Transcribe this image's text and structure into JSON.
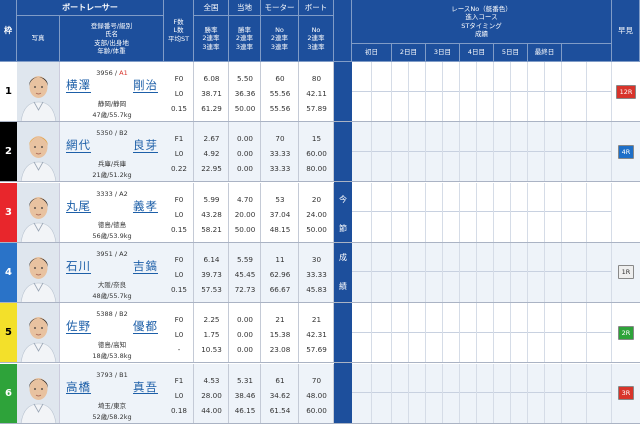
{
  "header": {
    "waku": "枠",
    "boat_racer": "ボートレーサー",
    "photo": "写真",
    "racer_info_lines": [
      "登録番号/級別",
      "氏名",
      "支部/出身地",
      "年齢/体重"
    ],
    "fl_st_lines": [
      "F数",
      "L数",
      "平均ST"
    ],
    "national": "全国",
    "local": "当地",
    "motor": "モーター",
    "boat": "ボート",
    "rate_lines": [
      "勝率",
      "2連率",
      "3連率"
    ],
    "motor_lines": [
      "No",
      "2連率",
      "3連率"
    ],
    "boat_lines": [
      "No",
      "2連率",
      "3連率"
    ],
    "race_info_lines": [
      "レースNo（艇番色）",
      "進入コース",
      "STタイミング",
      "成績"
    ],
    "days": [
      "初日",
      "2日目",
      "3日目",
      "4日目",
      "5日目",
      "最終日"
    ],
    "tenji": "早見",
    "konsetsu": [
      "今",
      "節",
      "成",
      "績"
    ]
  },
  "racers": [
    {
      "waku": "1",
      "reg": "3956",
      "cls": "A1",
      "name1": "横澤",
      "name2": "剛治",
      "pl": "静岡/静岡",
      "ag": "47歳/55.7kg",
      "f": "F0",
      "l": "L0",
      "st": "0.15",
      "nat": [
        "6.08",
        "38.71",
        "61.29"
      ],
      "loc": [
        "5.50",
        "36.36",
        "50.00"
      ],
      "mot": [
        "60",
        "55.56",
        "55.56"
      ],
      "bt": [
        "80",
        "42.11",
        "57.89"
      ],
      "tenji": "12R",
      "tenji_bg": "#d8342b",
      "tenji_fg": "#fff"
    },
    {
      "waku": "2",
      "reg": "5350",
      "cls": "B2",
      "name1": "網代",
      "name2": "良芽",
      "pl": "兵庫/兵庫",
      "ag": "21歳/51.2kg",
      "f": "F1",
      "l": "L0",
      "st": "0.22",
      "nat": [
        "2.67",
        "4.92",
        "22.95"
      ],
      "loc": [
        "0.00",
        "0.00",
        "0.00"
      ],
      "mot": [
        "70",
        "33.33",
        "33.33"
      ],
      "bt": [
        "15",
        "60.00",
        "80.00"
      ],
      "tenji": "4R",
      "tenji_bg": "#1e6fc8",
      "tenji_fg": "#fff"
    },
    {
      "waku": "3",
      "reg": "3333",
      "cls": "A2",
      "name1": "丸尾",
      "name2": "義孝",
      "pl": "徳島/徳島",
      "ag": "56歳/53.9kg",
      "f": "F0",
      "l": "L0",
      "st": "0.15",
      "nat": [
        "5.99",
        "43.28",
        "58.21"
      ],
      "loc": [
        "4.70",
        "20.00",
        "50.00"
      ],
      "mot": [
        "53",
        "37.04",
        "48.15"
      ],
      "bt": [
        "20",
        "24.00",
        "50.00"
      ],
      "tenji": "",
      "tenji_bg": "",
      "tenji_fg": ""
    },
    {
      "waku": "4",
      "reg": "3951",
      "cls": "A2",
      "name1": "石川",
      "name2": "吉鎬",
      "pl": "大阪/奈良",
      "ag": "48歳/55.7kg",
      "f": "F0",
      "l": "L0",
      "st": "0.15",
      "nat": [
        "6.14",
        "39.73",
        "57.53"
      ],
      "loc": [
        "5.59",
        "45.45",
        "72.73"
      ],
      "mot": [
        "11",
        "62.96",
        "66.67"
      ],
      "bt": [
        "30",
        "33.33",
        "45.83"
      ],
      "tenji": "1R",
      "tenji_bg": "#eeeeee",
      "tenji_fg": "#333"
    },
    {
      "waku": "5",
      "reg": "5388",
      "cls": "B2",
      "name1": "佐野",
      "name2": "優都",
      "pl": "徳島/高知",
      "ag": "18歳/53.8kg",
      "f": "F0",
      "l": "L0",
      "st": "-",
      "nat": [
        "2.25",
        "1.75",
        "10.53"
      ],
      "loc": [
        "0.00",
        "0.00",
        "0.00"
      ],
      "mot": [
        "21",
        "15.38",
        "23.08"
      ],
      "bt": [
        "21",
        "42.31",
        "57.69"
      ],
      "tenji": "2R",
      "tenji_bg": "#2ea33a",
      "tenji_fg": "#fff"
    },
    {
      "waku": "6",
      "reg": "3793",
      "cls": "B1",
      "name1": "高橋",
      "name2": "真吾",
      "pl": "埼玉/東京",
      "ag": "52歳/58.2kg",
      "f": "F1",
      "l": "L0",
      "st": "0.18",
      "nat": [
        "4.53",
        "28.00",
        "44.00"
      ],
      "loc": [
        "5.31",
        "38.46",
        "46.15"
      ],
      "mot": [
        "61",
        "34.62",
        "61.54"
      ],
      "bt": [
        "70",
        "48.00",
        "60.00"
      ],
      "tenji": "3R",
      "tenji_bg": "#d8342b",
      "tenji_fg": "#fff"
    }
  ],
  "colors": {
    "header_bg": "#1d4f9c",
    "waku": [
      [
        "#ffffff",
        "#000000"
      ],
      [
        "#000000",
        "#ffffff"
      ],
      [
        "#e8262c",
        "#ffffff"
      ],
      [
        "#2a73c8",
        "#ffffff"
      ],
      [
        "#f3e02a",
        "#000000"
      ],
      [
        "#2ea33a",
        "#ffffff"
      ]
    ],
    "class_a1": "#d8342b"
  }
}
